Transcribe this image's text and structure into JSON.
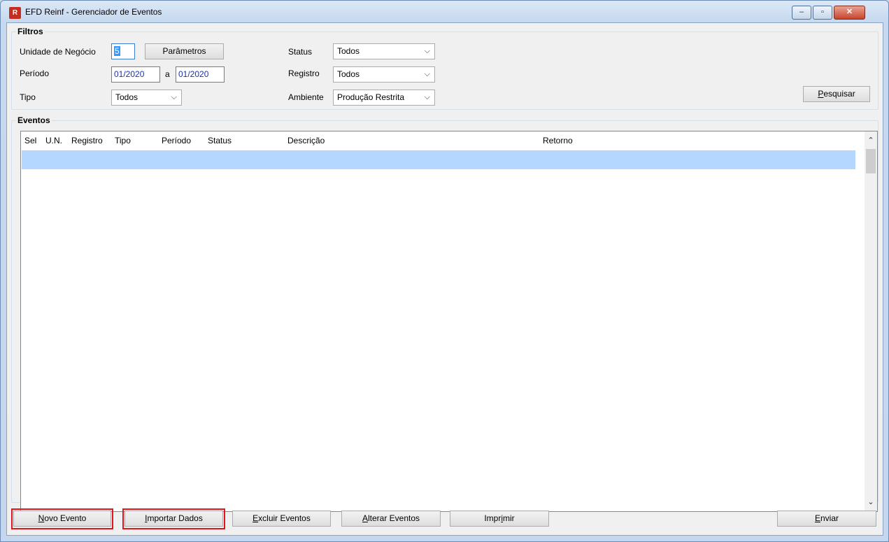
{
  "window": {
    "title": "EFD Reinf - Gerenciador de Eventos",
    "minimize_symbol": "–",
    "maximize_symbol": "▫",
    "close_symbol": "✕",
    "app_icon_glyph": "R"
  },
  "filtros": {
    "legend": "Filtros",
    "unidade_label": "Unidade de Negócio",
    "unidade_value": "5",
    "parametros_button": "Parâmetros",
    "periodo_label": "Período",
    "periodo_from": "01/2020",
    "periodo_sep": "a",
    "periodo_to": "01/2020",
    "tipo_label": "Tipo",
    "tipo_value": "Todos",
    "status_label": "Status",
    "status_value": "Todos",
    "registro_label": "Registro",
    "registro_value": "Todos",
    "ambiente_label": "Ambiente",
    "ambiente_value": "Produção Restrita",
    "pesquisar_button": "Pesquisar",
    "pesquisar_mnemonic": "P",
    "pesquisar_rest": "esquisar"
  },
  "eventos": {
    "legend": "Eventos",
    "columns": [
      "Sel",
      "U.N.",
      "Registro",
      "Tipo",
      "Período",
      "Status",
      "Descrição",
      "Retorno"
    ]
  },
  "buttons": {
    "novo_evento": {
      "mn": "N",
      "rest": "ovo Evento"
    },
    "importar_dados": {
      "mn": "I",
      "rest": "mportar Dados"
    },
    "excluir_eventos": {
      "mn": "E",
      "rest": "xcluir Eventos"
    },
    "alterar_eventos": {
      "mn": "A",
      "rest": "lterar Eventos"
    },
    "imprimir": {
      "pre": "Impr",
      "mn": "i",
      "rest": "mir"
    },
    "enviar": {
      "mn": "E",
      "rest": "nviar"
    }
  },
  "icons": {
    "chevron": "⌵",
    "scroll_up": "⌃",
    "scroll_down": "⌄"
  },
  "colors": {
    "highlight_border": "#e3141b",
    "selected_row": "#b3d7ff",
    "app_icon": "#c62d1f"
  }
}
